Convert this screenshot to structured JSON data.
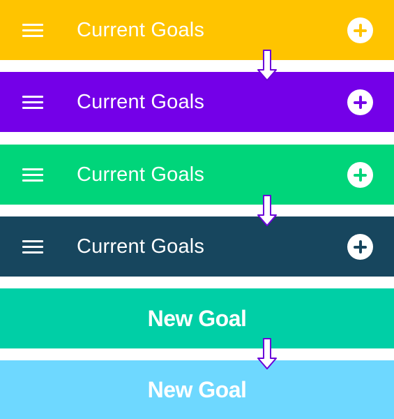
{
  "bars": [
    {
      "type": "goals",
      "title": "Current Goals",
      "bg": "#ffc400",
      "plus_color": "#ffc400",
      "menu_icon": "hamburger-menu-icon",
      "add_icon": "plus-circle-icon"
    },
    {
      "type": "goals",
      "title": "Current Goals",
      "bg": "#7400e8",
      "plus_color": "#7400e8",
      "menu_icon": "hamburger-menu-icon",
      "add_icon": "plus-circle-icon"
    },
    {
      "type": "goals",
      "title": "Current Goals",
      "bg": "#00d57a",
      "plus_color": "#00d57a",
      "menu_icon": "hamburger-menu-icon",
      "add_icon": "plus-circle-icon"
    },
    {
      "type": "goals",
      "title": "Current Goals",
      "bg": "#17465e",
      "plus_color": "#17465e",
      "menu_icon": "hamburger-menu-icon",
      "add_icon": "plus-circle-icon"
    },
    {
      "type": "new_goal",
      "title": "New Goal",
      "bg": "#00cfa6"
    },
    {
      "type": "new_goal",
      "title": "New Goal",
      "bg": "#6ed8ff"
    }
  ],
  "transition_arrow": {
    "icon": "down-arrow-icon",
    "stroke": "#6a00d8",
    "fill": "#ffffff"
  }
}
